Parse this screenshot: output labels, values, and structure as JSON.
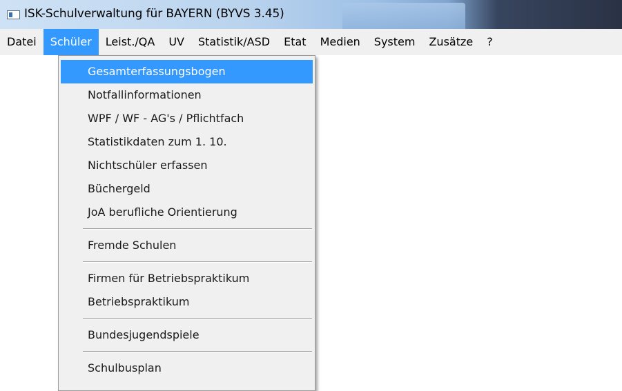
{
  "window": {
    "title": "ISK-Schulverwaltung für BAYERN (BYVS  3.45)"
  },
  "menubar": {
    "items": [
      {
        "label": "Datei"
      },
      {
        "label": "Schüler",
        "active": true
      },
      {
        "label": "Leist./QA"
      },
      {
        "label": "UV"
      },
      {
        "label": "Statistik/ASD"
      },
      {
        "label": "Etat"
      },
      {
        "label": "Medien"
      },
      {
        "label": "System"
      },
      {
        "label": "Zusätze"
      },
      {
        "label": "?"
      }
    ]
  },
  "dropdown": {
    "groups": [
      [
        "Gesamterfassungsbogen",
        "Notfallinformationen",
        "WPF / WF - AG's / Pflichtfach",
        "Statistikdaten zum 1. 10.",
        "Nichtschüler erfassen",
        "Büchergeld",
        "JoA berufliche Orientierung"
      ],
      [
        "Fremde Schulen"
      ],
      [
        "Firmen für Betriebspraktikum",
        "Betriebspraktikum"
      ],
      [
        "Bundesjugendspiele"
      ],
      [
        "Schulbusplan"
      ]
    ],
    "highlighted": "Gesamterfassungsbogen"
  },
  "colors": {
    "highlight": "#3399ff",
    "menu_background": "#f0f0f0"
  },
  "icons": {
    "app": "application-window-icon"
  }
}
